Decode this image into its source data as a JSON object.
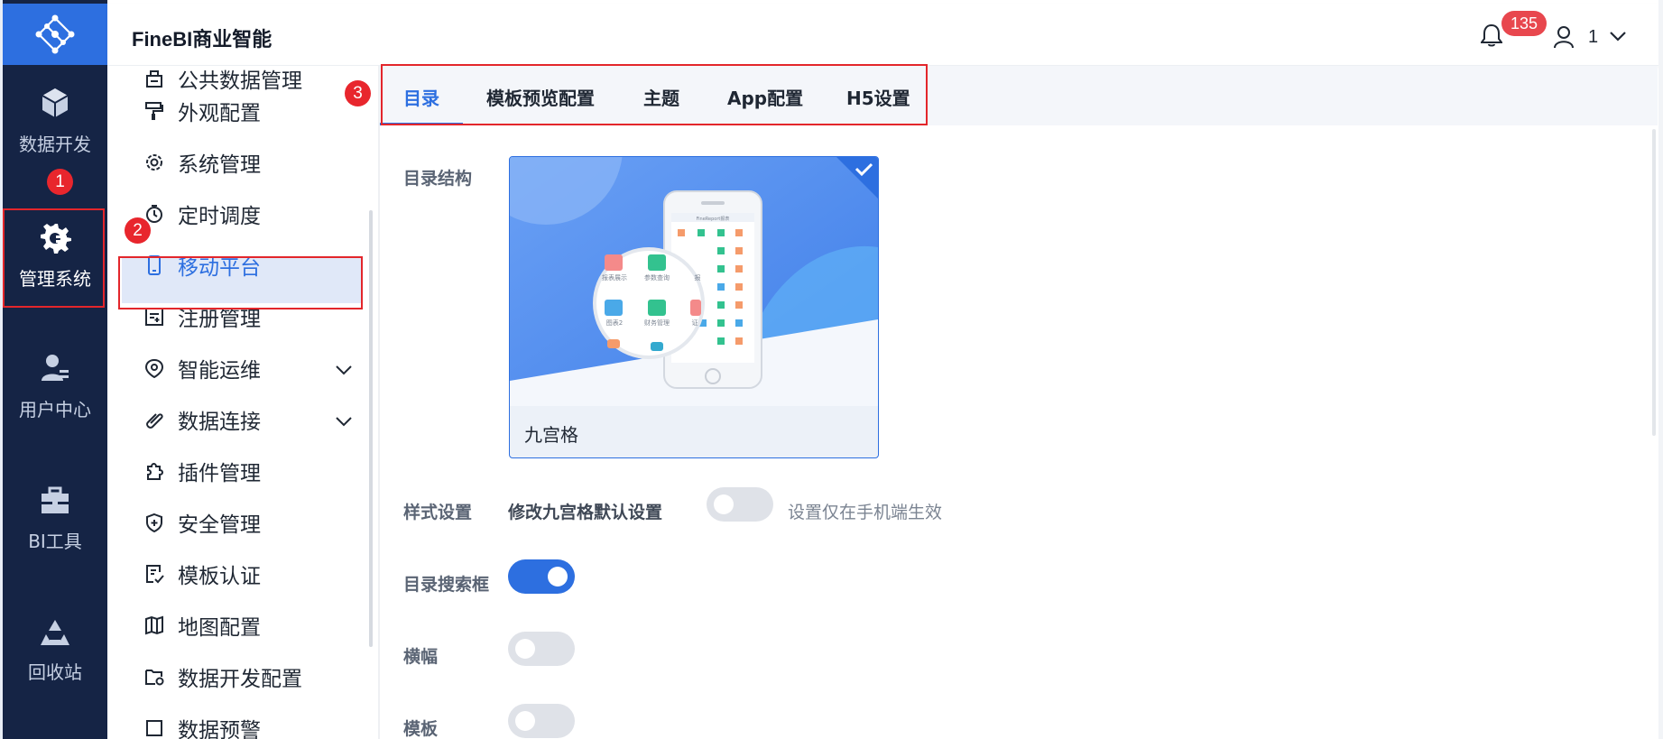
{
  "app": {
    "title": "FineBI商业智能",
    "notifications": "135",
    "user": "1"
  },
  "rail": {
    "items": [
      {
        "label": "数据开发",
        "icon": "cube-icon"
      },
      {
        "label": "管理系统",
        "icon": "gear-icon"
      },
      {
        "label": "用户中心",
        "icon": "user-group-icon"
      },
      {
        "label": "BI工具",
        "icon": "toolbox-icon"
      },
      {
        "label": "回收站",
        "icon": "recycle-icon"
      }
    ]
  },
  "submenu": {
    "items": [
      {
        "label": "公共数据管理",
        "icon": "public-data-icon"
      },
      {
        "label": "外观配置",
        "icon": "paint-roller-icon"
      },
      {
        "label": "系统管理",
        "icon": "settings-icon"
      },
      {
        "label": "定时调度",
        "icon": "timer-icon"
      },
      {
        "label": "移动平台",
        "icon": "mobile-icon"
      },
      {
        "label": "注册管理",
        "icon": "register-icon"
      },
      {
        "label": "智能运维",
        "icon": "ops-icon"
      },
      {
        "label": "数据连接",
        "icon": "link-icon"
      },
      {
        "label": "插件管理",
        "icon": "plugin-icon"
      },
      {
        "label": "安全管理",
        "icon": "shield-icon"
      },
      {
        "label": "模板认证",
        "icon": "template-auth-icon"
      },
      {
        "label": "地图配置",
        "icon": "map-icon"
      },
      {
        "label": "数据开发配置",
        "icon": "folder-gear-icon"
      },
      {
        "label": "数据预警",
        "icon": "alert-icon"
      }
    ]
  },
  "annotations": [
    "1",
    "2",
    "3"
  ],
  "tabs": [
    {
      "label": "目录"
    },
    {
      "label": "模板预览配置"
    },
    {
      "label": "主题"
    },
    {
      "label": "App配置"
    },
    {
      "label": "H5设置"
    }
  ],
  "catalog": {
    "structure_label": "目录结构",
    "card_caption": "九宫格",
    "style_label": "样式设置",
    "style_option": "修改九宫格默认设置",
    "style_hint": "设置仅在手机端生效",
    "search_label": "目录搜索框",
    "landscape_label": "横幅",
    "template_label": "模板"
  },
  "phone": {
    "header": "FineReport报表",
    "lens_labels": [
      "报表展示",
      "参数查询",
      "报",
      "图表2",
      "财务管理",
      "证"
    ]
  },
  "toggles": {
    "style_default": false,
    "search_box": true,
    "landscape": false,
    "template": false
  },
  "colors": {
    "accent": "#2d6fe0",
    "rail_bg": "#152445",
    "highlight_red": "#e3262b"
  }
}
